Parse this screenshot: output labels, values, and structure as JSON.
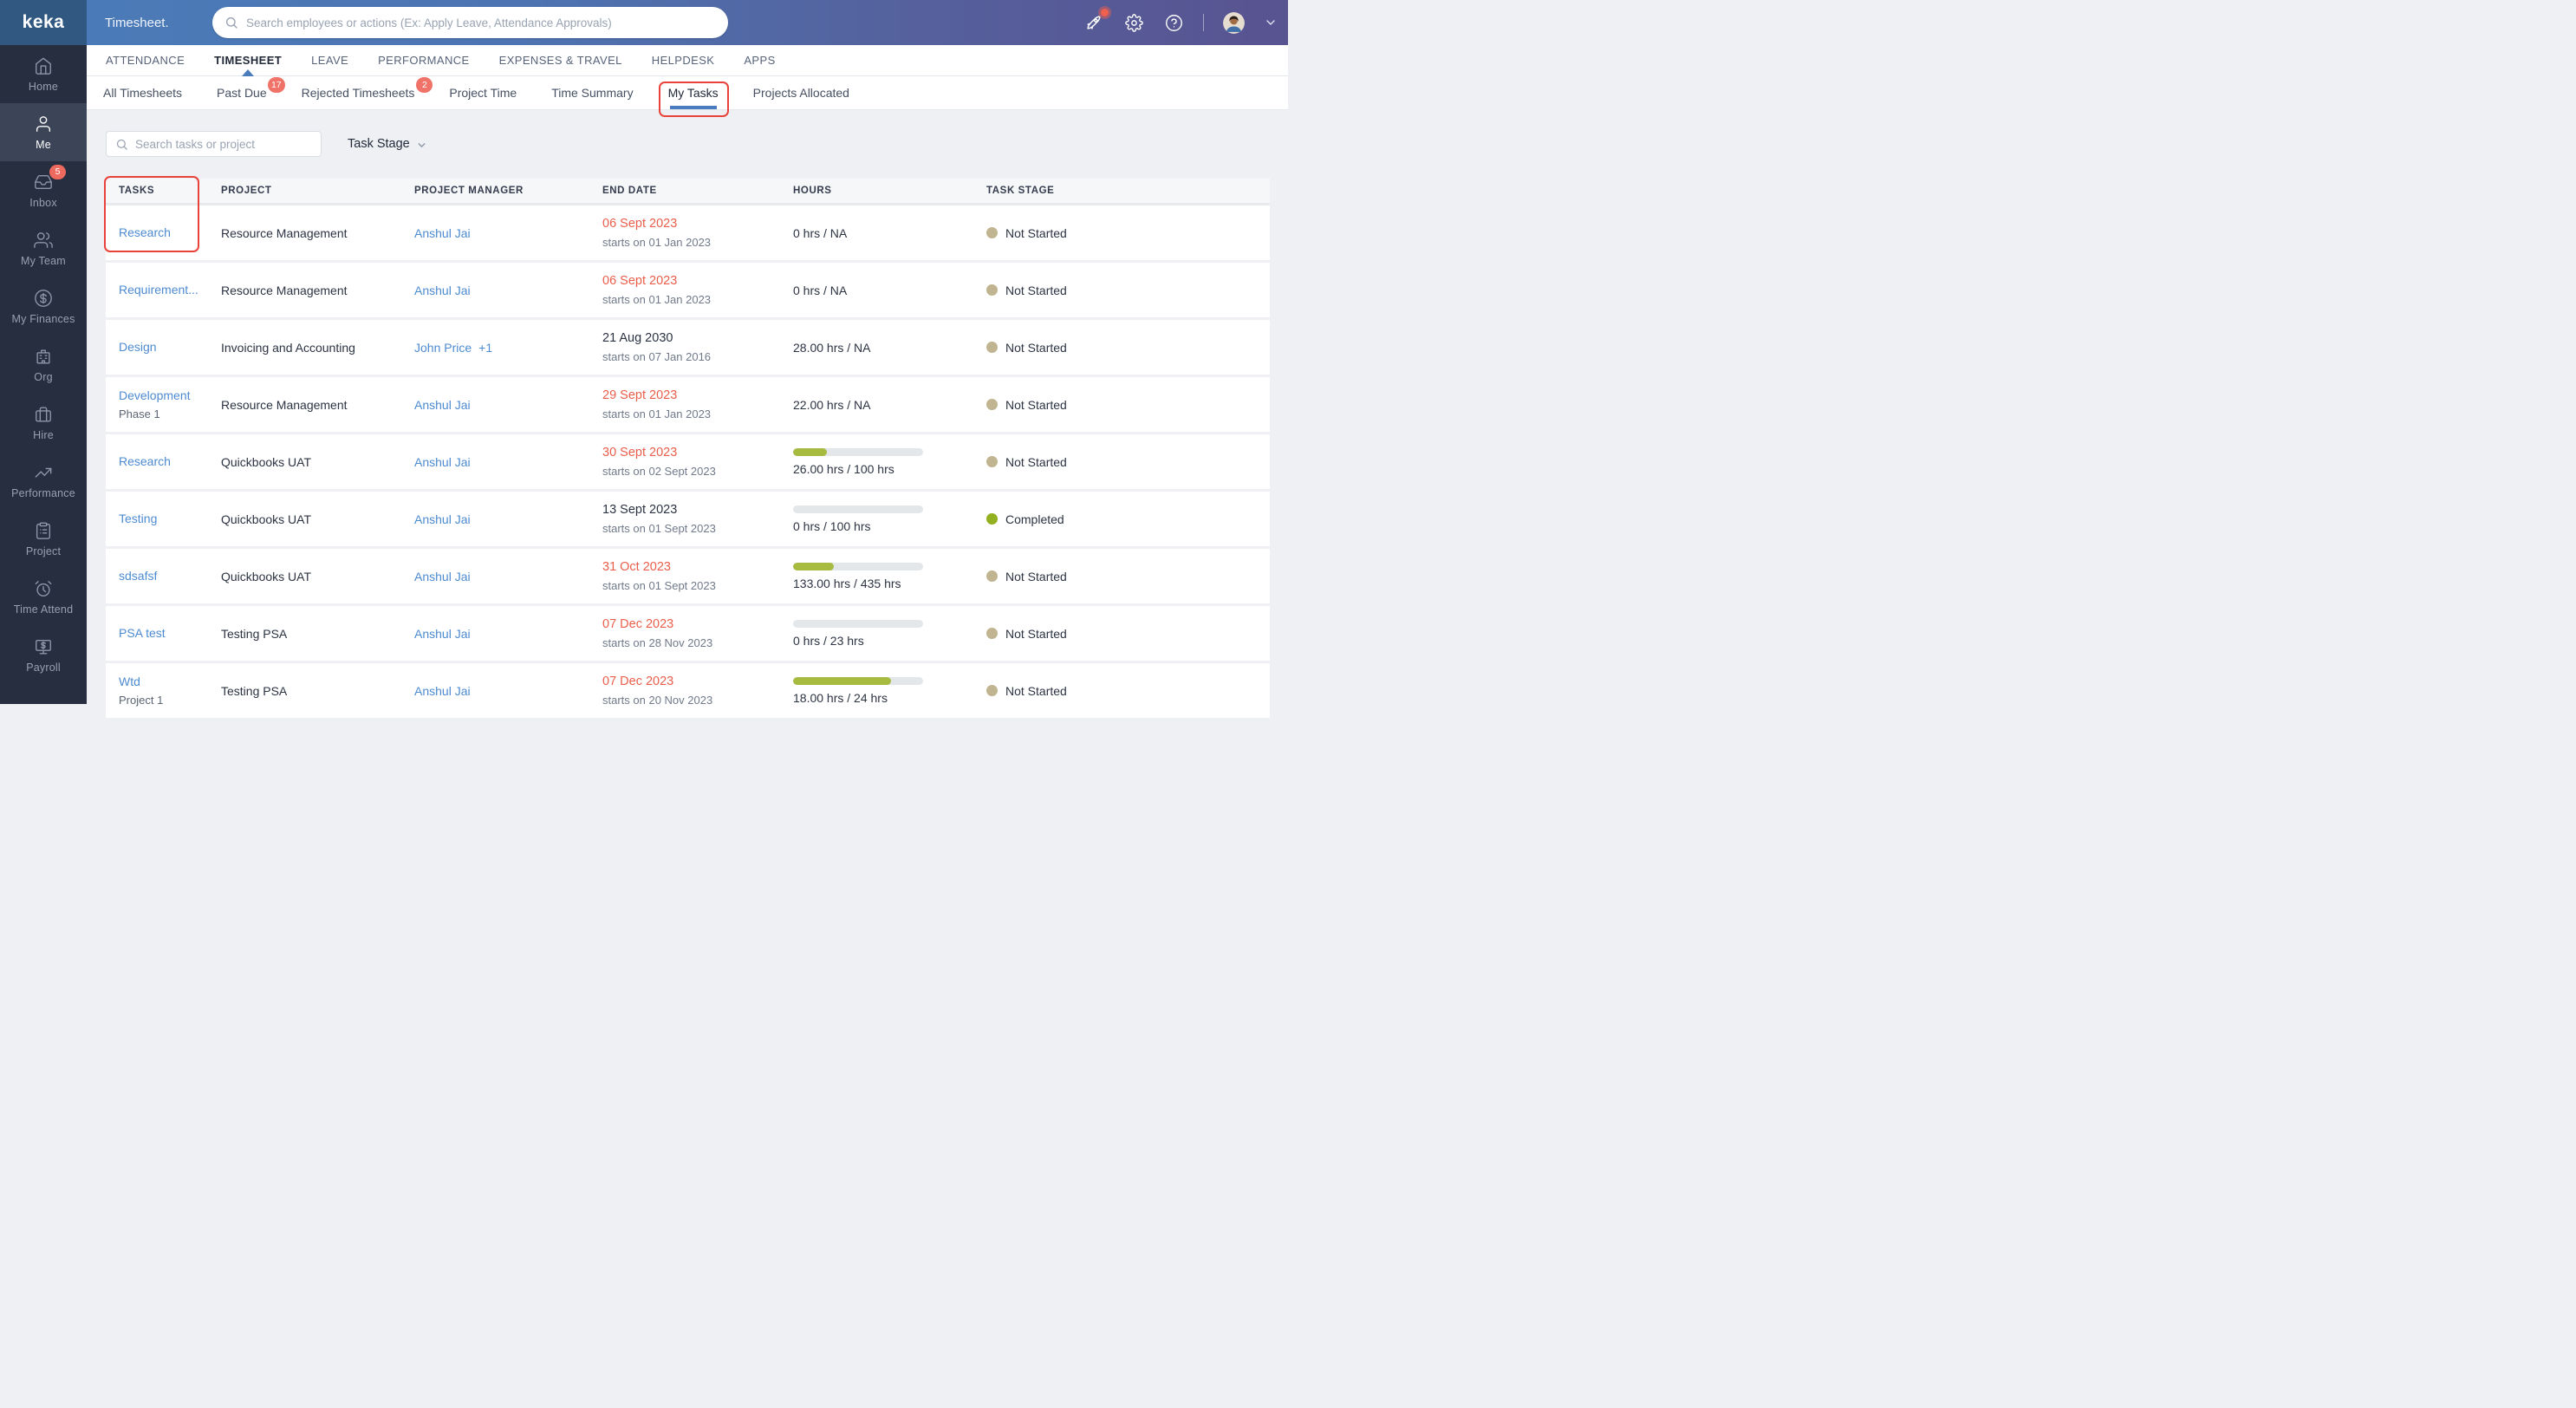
{
  "brand": {
    "logo_text": "keka",
    "logo_icon": "keka-spark-icon"
  },
  "header": {
    "app_title": "Timesheet.",
    "search_placeholder": "Search employees or actions (Ex: Apply Leave, Attendance Approvals)",
    "icons": [
      "rocket-icon",
      "gear-icon",
      "help-icon",
      "chevron-down-icon"
    ],
    "rocket_has_notification": true,
    "avatar": "user-avatar"
  },
  "nav_tabs": [
    {
      "label": "ATTENDANCE",
      "active": false
    },
    {
      "label": "TIMESHEET",
      "active": true
    },
    {
      "label": "LEAVE",
      "active": false
    },
    {
      "label": "PERFORMANCE",
      "active": false
    },
    {
      "label": "EXPENSES & TRAVEL",
      "active": false
    },
    {
      "label": "HELPDESK",
      "active": false
    },
    {
      "label": "APPS",
      "active": false
    }
  ],
  "sub_tabs": [
    {
      "label": "All Timesheets",
      "badge": "",
      "active": false,
      "annotated": false
    },
    {
      "label": "Past Due",
      "badge": "17",
      "active": false,
      "annotated": false
    },
    {
      "label": "Rejected Timesheets",
      "badge": "2",
      "active": false,
      "annotated": false
    },
    {
      "label": "Project Time",
      "badge": "",
      "active": false,
      "annotated": false
    },
    {
      "label": "Time Summary",
      "badge": "",
      "active": false,
      "annotated": false
    },
    {
      "label": "My Tasks",
      "badge": "",
      "active": true,
      "annotated": true
    },
    {
      "label": "Projects Allocated",
      "badge": "",
      "active": false,
      "annotated": false
    }
  ],
  "filters": {
    "search_placeholder": "Search tasks or project",
    "task_stage_label": "Task Stage"
  },
  "sidebar": {
    "items": [
      {
        "label": "Home",
        "icon": "home-icon",
        "badge": "",
        "active": false
      },
      {
        "label": "Me",
        "icon": "user-icon",
        "badge": "",
        "active": true
      },
      {
        "label": "Inbox",
        "icon": "inbox-icon",
        "badge": "5",
        "active": false
      },
      {
        "label": "My Team",
        "icon": "team-icon",
        "badge": "",
        "active": false
      },
      {
        "label": "My Finances",
        "icon": "finance-icon",
        "badge": "",
        "active": false
      },
      {
        "label": "Org",
        "icon": "org-icon",
        "badge": "",
        "active": false
      },
      {
        "label": "Hire",
        "icon": "hire-icon",
        "badge": "",
        "active": false
      },
      {
        "label": "Performance",
        "icon": "performance-icon",
        "badge": "",
        "active": false
      },
      {
        "label": "Project",
        "icon": "project-icon",
        "badge": "",
        "active": false
      },
      {
        "label": "Time Attend",
        "icon": "time-icon",
        "badge": "",
        "active": false
      },
      {
        "label": "Payroll",
        "icon": "payroll-icon",
        "badge": "",
        "active": false
      }
    ]
  },
  "table": {
    "columns": [
      "TASKS",
      "PROJECT",
      "PROJECT MANAGER",
      "END DATE",
      "HOURS",
      "TASK STAGE"
    ],
    "rows": [
      {
        "task": "Research",
        "task_sub": "",
        "project": "Resource Management",
        "manager": "Anshul Jai",
        "manager_extra": "",
        "end_date": "06 Sept 2023",
        "end_date_overdue": true,
        "starts_on": "starts on 01 Jan 2023",
        "hours": "0 hrs / NA",
        "progress_pct": null,
        "stage": "Not Started",
        "stage_key": "not_started"
      },
      {
        "task": "Requirement...",
        "task_sub": "",
        "project": "Resource Management",
        "manager": "Anshul Jai",
        "manager_extra": "",
        "end_date": "06 Sept 2023",
        "end_date_overdue": true,
        "starts_on": "starts on 01 Jan 2023",
        "hours": "0 hrs / NA",
        "progress_pct": null,
        "stage": "Not Started",
        "stage_key": "not_started"
      },
      {
        "task": "Design",
        "task_sub": "",
        "project": "Invoicing and Accounting",
        "manager": "John Price",
        "manager_extra": "+1",
        "end_date": "21 Aug 2030",
        "end_date_overdue": false,
        "starts_on": "starts on 07 Jan 2016",
        "hours": "28.00 hrs / NA",
        "progress_pct": null,
        "stage": "Not Started",
        "stage_key": "not_started"
      },
      {
        "task": "Development",
        "task_sub": "Phase 1",
        "project": "Resource Management",
        "manager": "Anshul Jai",
        "manager_extra": "",
        "end_date": "29 Sept 2023",
        "end_date_overdue": true,
        "starts_on": "starts on 01 Jan 2023",
        "hours": "22.00 hrs / NA",
        "progress_pct": null,
        "stage": "Not Started",
        "stage_key": "not_started"
      },
      {
        "task": "Research",
        "task_sub": "",
        "project": "Quickbooks UAT",
        "manager": "Anshul Jai",
        "manager_extra": "",
        "end_date": "30 Sept 2023",
        "end_date_overdue": true,
        "starts_on": "starts on 02 Sept 2023",
        "hours": "26.00 hrs / 100 hrs",
        "progress_pct": 26,
        "stage": "Not Started",
        "stage_key": "not_started"
      },
      {
        "task": "Testing",
        "task_sub": "",
        "project": "Quickbooks UAT",
        "manager": "Anshul Jai",
        "manager_extra": "",
        "end_date": "13 Sept 2023",
        "end_date_overdue": false,
        "starts_on": "starts on 01 Sept 2023",
        "hours": "0 hrs / 100 hrs",
        "progress_pct": 0,
        "stage": "Completed",
        "stage_key": "completed"
      },
      {
        "task": "sdsafsf",
        "task_sub": "",
        "project": "Quickbooks UAT",
        "manager": "Anshul Jai",
        "manager_extra": "",
        "end_date": "31 Oct 2023",
        "end_date_overdue": true,
        "starts_on": "starts on 01 Sept 2023",
        "hours": "133.00 hrs / 435 hrs",
        "progress_pct": 31,
        "stage": "Not Started",
        "stage_key": "not_started"
      },
      {
        "task": "PSA test",
        "task_sub": "",
        "project": "Testing PSA",
        "manager": "Anshul Jai",
        "manager_extra": "",
        "end_date": "07 Dec 2023",
        "end_date_overdue": true,
        "starts_on": "starts on 28 Nov 2023",
        "hours": "0 hrs / 23 hrs",
        "progress_pct": 0,
        "stage": "Not Started",
        "stage_key": "not_started"
      },
      {
        "task": "Wtd",
        "task_sub": "Project 1",
        "project": "Testing PSA",
        "manager": "Anshul Jai",
        "manager_extra": "",
        "end_date": "07 Dec 2023",
        "end_date_overdue": true,
        "starts_on": "starts on 20 Nov 2023",
        "hours": "18.00 hrs / 24 hrs",
        "progress_pct": 75,
        "stage": "Not Started",
        "stage_key": "not_started"
      }
    ]
  },
  "annotations": {
    "color": "#e8423a",
    "boxes": [
      "my-tasks-tab",
      "tasks-column-and-first-task"
    ]
  },
  "colors": {
    "header_gradient_left": "#4a7cb9",
    "header_gradient_right": "#585391",
    "logo_box": "#315880",
    "sidebar_bg": "#272e40",
    "accent_blue": "#4a7bc0",
    "link_blue": "#4d8bd1",
    "overdue_red": "#ea5e4b",
    "badge_red": "#f07268",
    "progress_green": "#a7bb41",
    "stage_not_started": "#c1b591",
    "stage_completed": "#92b01f"
  }
}
